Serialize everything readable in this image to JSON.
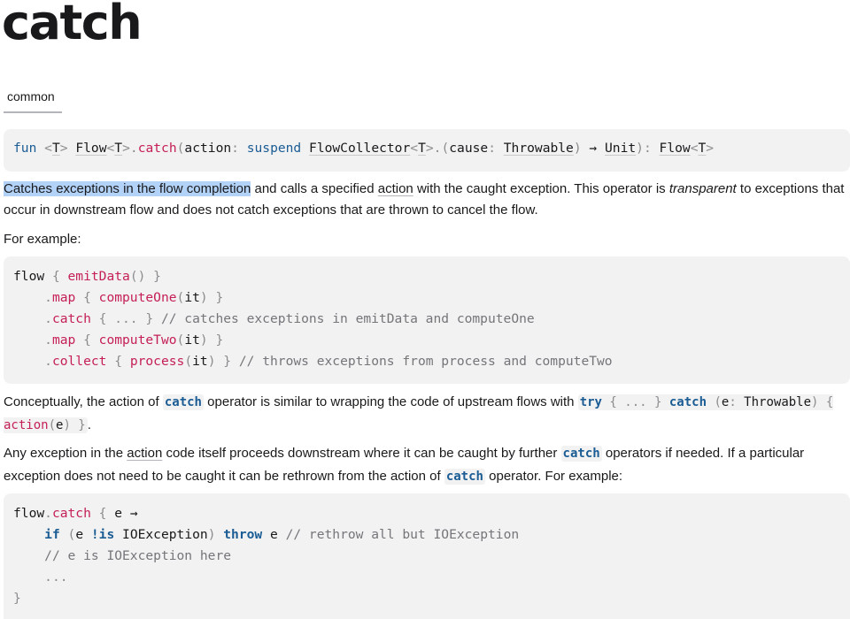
{
  "title": "catch",
  "platform_tab": "common",
  "signature": {
    "fun": "fun",
    "lt1": "<",
    "T1": "T",
    "gt1": ">",
    "flow_type": "Flow",
    "lt2": "<",
    "T2": "T",
    "gt2": ">",
    "dot": ".",
    "name": "catch",
    "paren_open": "(",
    "param": "action",
    "colon1": ": ",
    "suspend": "suspend",
    "collector": "FlowCollector",
    "lt3": "<",
    "T3": "T",
    "gt3": ">",
    "dot2": ".",
    "paren_open2": "(",
    "cause": "cause",
    "colon2": ": ",
    "throwable": "Throwable",
    "paren_close2": ")",
    "arrow": " → ",
    "unit": "Unit",
    "paren_close": ")",
    "colon3": ": ",
    "ret_flow": "Flow",
    "lt4": "<",
    "T4": "T",
    "gt4": ">"
  },
  "desc": {
    "highlight": "Catches exceptions in the flow completion",
    "t1": " and calls a specified ",
    "action_link": "action",
    "t2": " with the caught exception. This operator is ",
    "transparent": "transparent",
    "t3": " to exceptions that occur in downstream flow and does not catch exceptions that are thrown to cancel the flow."
  },
  "for_example": "For example:",
  "example1": {
    "l1_a": "flow",
    "l1_b": " { ",
    "l1_c": "emitData",
    "l1_d": "() }",
    "l2_a": "    .",
    "l2_b": "map",
    "l2_c": " { ",
    "l2_d": "computeOne",
    "l2_e": "(",
    "l2_f": "it",
    "l2_g": ") }",
    "l3_a": "    .",
    "l3_b": "catch",
    "l3_c": " { ... } ",
    "l3_d": "// catches exceptions in emitData and computeOne",
    "l4_a": "    .",
    "l4_b": "map",
    "l4_c": " { ",
    "l4_d": "computeTwo",
    "l4_e": "(",
    "l4_f": "it",
    "l4_g": ") }",
    "l5_a": "    .",
    "l5_b": "collect",
    "l5_c": " { ",
    "l5_d": "process",
    "l5_e": "(",
    "l5_f": "it",
    "l5_g": ") } ",
    "l5_h": "// throws exceptions from process and computeTwo"
  },
  "concept": {
    "t1": "Conceptually, the action of ",
    "catch_code": "catch",
    "t2": " operator is similar to wrapping the code of upstream flows with ",
    "try_kw": "try",
    "try_rest": " { ... } ",
    "catch_kw": "catch",
    "catch_rest_a": " (",
    "e": "e",
    "colon": ": ",
    "throwable": "Throwable",
    "brace": ") { ",
    "action": "action",
    "paren_open": "(",
    "e2": "e",
    "paren_close": ") }",
    "period": "."
  },
  "any_exc": {
    "t1": "Any exception in the ",
    "action_link": "action",
    "t2": " code itself proceeds downstream where it can be caught by further ",
    "catch_code": "catch",
    "t3": " operators if needed. If a particular exception does not need to be caught it can be rethrown from the action of ",
    "catch_code2": "catch",
    "t4": " operator. For example:"
  },
  "example2": {
    "l1_a": "flow",
    "l1_b": ".",
    "l1_c": "catch",
    "l1_d": " { ",
    "l1_e": "e",
    "l1_f": " →",
    "l2_a": "    ",
    "l2_b": "if",
    "l2_c": " (",
    "l2_d": "e ",
    "l2_e": "!is",
    "l2_f": " IOException",
    "l2_g": ") ",
    "l2_h": "throw",
    "l2_i": " e ",
    "l2_j": "// rethrow all but IOException",
    "l3_a": "    ",
    "l3_b": "// e is IOException here",
    "l4_a": "    ",
    "l4_b": "...",
    "l5": "}"
  },
  "colors": {
    "keyword": "#1a5c93",
    "function": "#c52055",
    "comment": "#75757a",
    "highlight": "#b3d2f7",
    "code_bg": "#f2f2f3"
  }
}
